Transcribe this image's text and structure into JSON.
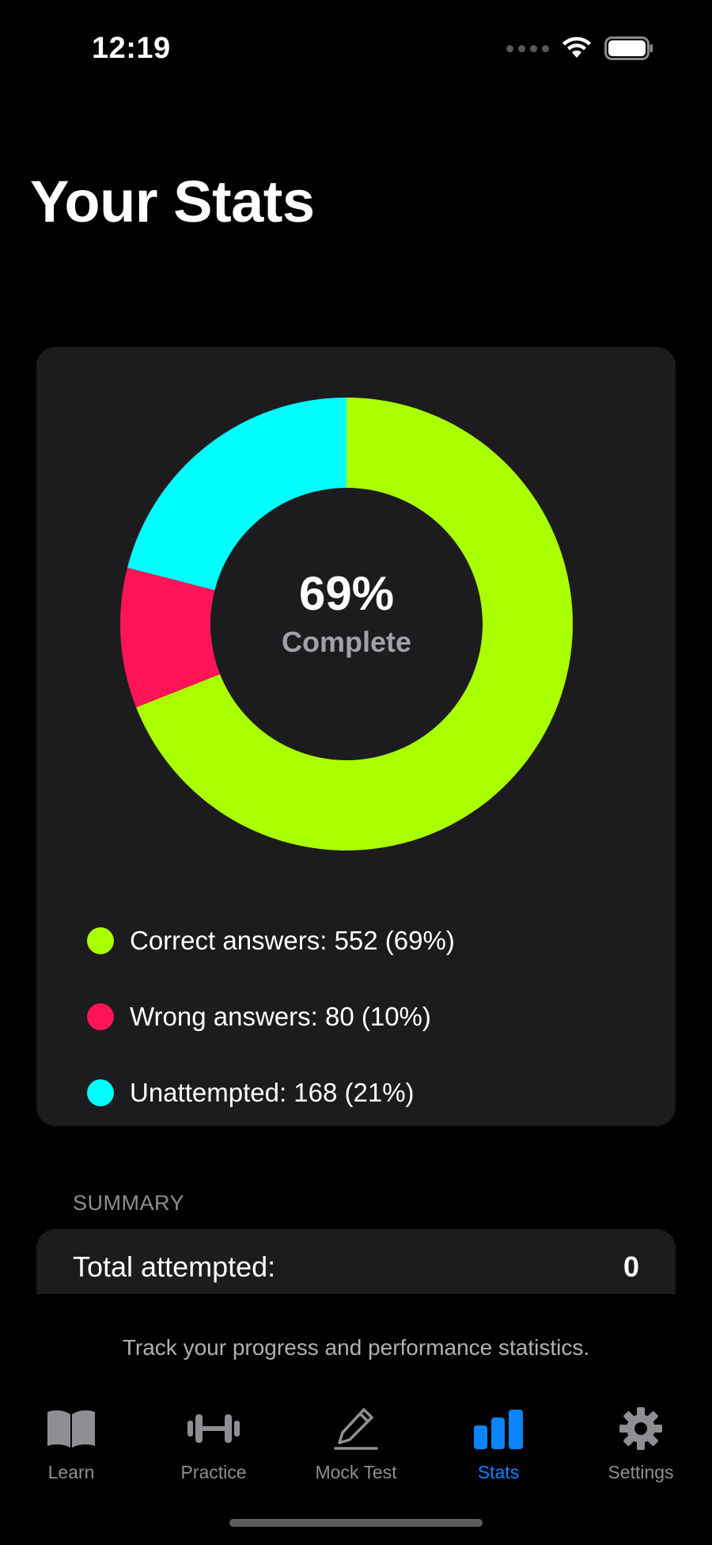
{
  "status_bar": {
    "time": "12:19"
  },
  "page": {
    "title": "Your Stats"
  },
  "chart_data": {
    "type": "pie",
    "categories": [
      "Correct answers",
      "Wrong answers",
      "Unattempted"
    ],
    "values": [
      552,
      80,
      168
    ],
    "percents": [
      69,
      10,
      21
    ],
    "colors": [
      "#aaff00",
      "#ff1458",
      "#00ffff"
    ],
    "center_value": "69%",
    "center_label": "Complete",
    "legend": [
      {
        "text": "Correct answers: 552 (69%)",
        "color": "#aaff00"
      },
      {
        "text": "Wrong answers: 80 (10%)",
        "color": "#ff1458"
      },
      {
        "text": "Unattempted: 168 (21%)",
        "color": "#00ffff"
      }
    ]
  },
  "summary": {
    "header": "SUMMARY",
    "rows": [
      {
        "label": "Total attempted:",
        "value": "0"
      }
    ]
  },
  "footer": {
    "text": "Track your progress and performance statistics."
  },
  "tabs": [
    {
      "label": "Learn",
      "icon": "book-icon",
      "active": false
    },
    {
      "label": "Practice",
      "icon": "dumbbell-icon",
      "active": false
    },
    {
      "label": "Mock Test",
      "icon": "pencil-icon",
      "active": false
    },
    {
      "label": "Stats",
      "icon": "bar-chart-icon",
      "active": true
    },
    {
      "label": "Settings",
      "icon": "gear-icon",
      "active": false
    }
  ],
  "colors": {
    "background": "#000000",
    "card": "#1c1c1e",
    "accent": "#0a84ff",
    "inactive": "#8e8e93"
  }
}
